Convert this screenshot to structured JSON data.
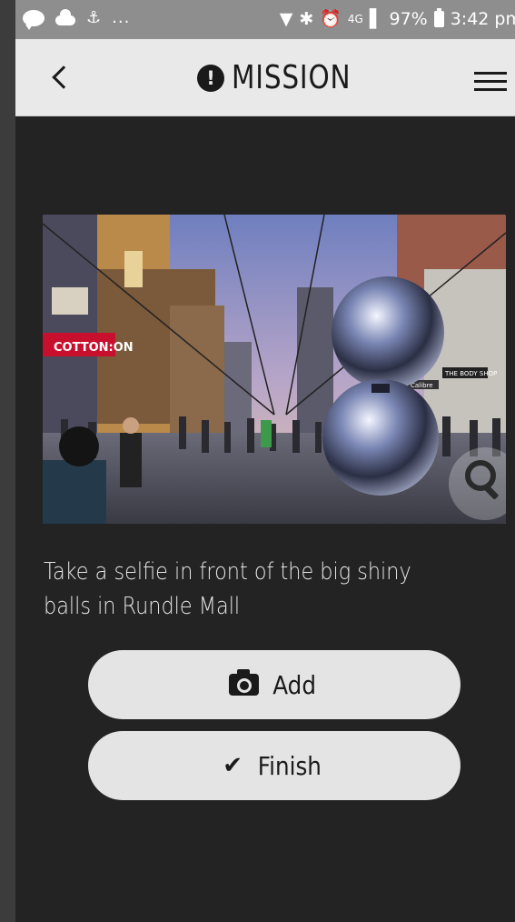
{
  "status_bar": {
    "overflow": "...",
    "network": "4G",
    "battery": "97%",
    "time": "3:42 pm"
  },
  "header": {
    "title": "MISSION",
    "title_icon": "exclamation-circle-icon",
    "back_icon": "chevron-left-icon",
    "menu_icon": "hamburger-menu-icon"
  },
  "mission": {
    "photo_signs": {
      "store1": "COTTON:ON",
      "store2": "Calibre",
      "store3": "THE BODY SHOP"
    },
    "zoom_icon": "search-icon",
    "description": "Take a selfie in front of the big shiny balls in Rundle Mall"
  },
  "actions": {
    "add_label": "Add",
    "add_icon": "camera-icon",
    "finish_label": "Finish",
    "finish_icon": "check-icon"
  },
  "colors": {
    "background": "#232323",
    "header": "#e9e9e9",
    "button": "#e4e4e4",
    "status_bar": "#8e8e8e",
    "sign_red": "#c8102e"
  }
}
